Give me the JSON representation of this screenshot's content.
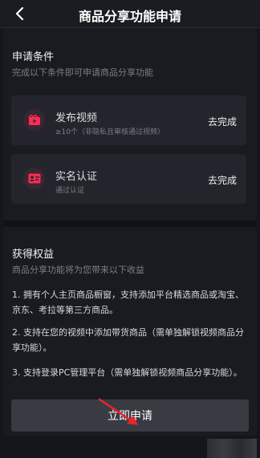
{
  "header": {
    "title": "商品分享功能申请",
    "back_icon": "chevron-left-icon"
  },
  "conditions": {
    "title": "申请条件",
    "subtitle": "完成以下条件即可申请商品分享功能",
    "items": [
      {
        "title": "发布视频",
        "desc": "≥10个（非隐私且审核通过视频）",
        "status": "去完成",
        "icon": "video-icon",
        "icon_color": "#fe2c55"
      },
      {
        "title": "实名认证",
        "desc": "通过认证",
        "status": "去完成",
        "icon": "id-card-icon",
        "icon_color": "#fe2c55"
      }
    ]
  },
  "benefits": {
    "title": "获得权益",
    "subtitle": "商品分享功能将为您带来以下收益",
    "items": [
      "1. 拥有个人主页商品橱窗，支持添加平台精选商品或淘宝、京东、考拉等第三方商品。",
      "2. 支持在您的视频中添加带货商品（需单独解锁视频商品分享功能）。",
      "3. 支持登录PC管理平台（需单独解锁视频商品分享功能）。"
    ]
  },
  "footer": {
    "apply_label": "立即申请"
  },
  "colors": {
    "accent": "#fe2c55",
    "annotation_arrow": "#e8262a"
  }
}
